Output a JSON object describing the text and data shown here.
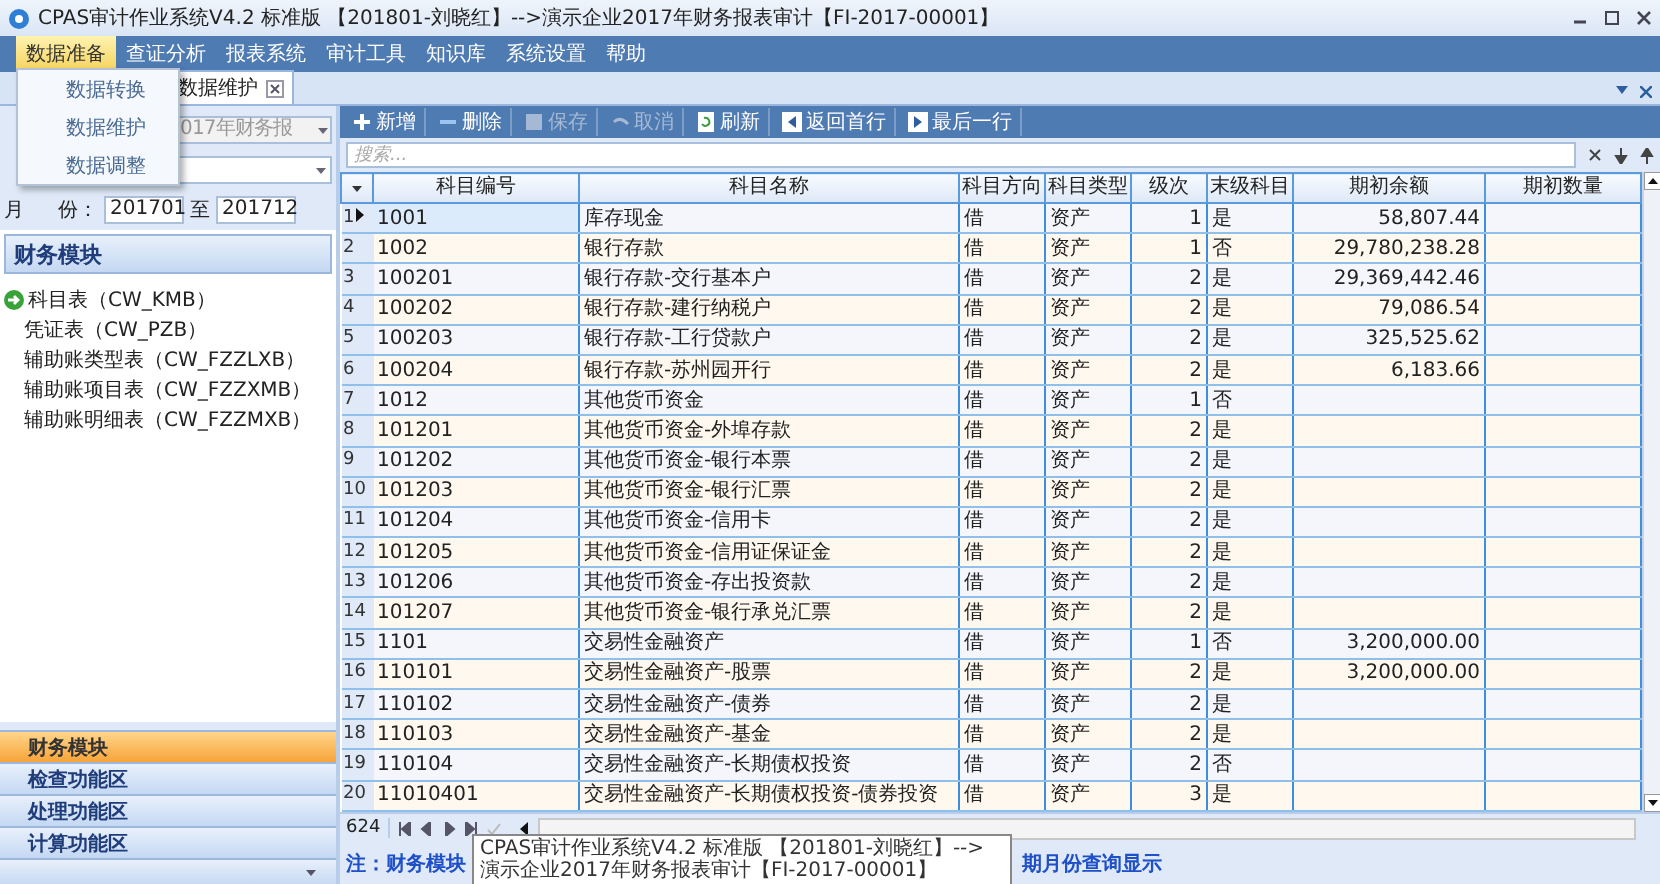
{
  "window": {
    "title": "CPAS审计作业系统V4.2 标准版 【201801-刘晓红】-->演示企业2017年财务报表审计【FI-2017-00001】"
  },
  "menu": [
    {
      "label": "数据准备",
      "selected": true
    },
    {
      "label": "查证分析",
      "selected": false
    },
    {
      "label": "报表系统",
      "selected": false
    },
    {
      "label": "审计工具",
      "selected": false
    },
    {
      "label": "知识库",
      "selected": false
    },
    {
      "label": "系统设置",
      "selected": false
    },
    {
      "label": "帮助",
      "selected": false
    }
  ],
  "dropdown": {
    "items": [
      "数据转换",
      "数据维护",
      "数据调整"
    ]
  },
  "tabs": [
    {
      "label": "数据维护",
      "selected": true
    }
  ],
  "filters": {
    "project_value": "017年财务报",
    "month_label": "月",
    "month_label_2": "份：",
    "from": "201701",
    "to_label": "至",
    "to": "201712"
  },
  "sidebar": {
    "header": "财务模块",
    "items": [
      {
        "label": "科目表（CW_KMB）",
        "selected": true
      },
      {
        "label": "凭证表（CW_PZB）",
        "selected": false
      },
      {
        "label": "辅助账类型表（CW_FZZLXB）",
        "selected": false
      },
      {
        "label": "辅助账项目表（CW_FZZXMB）",
        "selected": false
      },
      {
        "label": "辅助账明细表（CW_FZZMXB）",
        "selected": false
      }
    ],
    "nav": [
      {
        "label": "财务模块",
        "selected": true
      },
      {
        "label": "检查功能区",
        "selected": false
      },
      {
        "label": "处理功能区",
        "selected": false
      },
      {
        "label": "计算功能区",
        "selected": false
      }
    ]
  },
  "toolbar": [
    {
      "label": "新增",
      "kind": "add",
      "disabled": false
    },
    {
      "label": "删除",
      "kind": "delete",
      "disabled": false
    },
    {
      "label": "保存",
      "kind": "save",
      "disabled": true
    },
    {
      "label": "取消",
      "kind": "undo",
      "disabled": true
    },
    {
      "label": "刷新",
      "kind": "refresh",
      "disabled": false
    },
    {
      "label": "返回首行",
      "kind": "first",
      "disabled": false
    },
    {
      "label": "最后一行",
      "kind": "last",
      "disabled": false
    }
  ],
  "search": {
    "placeholder": "搜索..."
  },
  "table": {
    "columns": [
      "科目编号",
      "科目名称",
      "科目方向",
      "科目类型",
      "级次",
      "末级科目",
      "期初余额",
      "期初数量"
    ],
    "rows": [
      {
        "n": "1",
        "selected": true,
        "cells": [
          "1001",
          "库存现金",
          "借",
          "资产",
          "1",
          "是",
          "58,807.44"
        ]
      },
      {
        "n": "2",
        "selected": false,
        "cells": [
          "1002",
          "银行存款",
          "借",
          "资产",
          "1",
          "否",
          "29,780,238.28"
        ]
      },
      {
        "n": "3",
        "selected": false,
        "cells": [
          "100201",
          "银行存款-交行基本户",
          "借",
          "资产",
          "2",
          "是",
          "29,369,442.46"
        ]
      },
      {
        "n": "4",
        "selected": false,
        "cells": [
          "100202",
          "银行存款-建行纳税户",
          "借",
          "资产",
          "2",
          "是",
          "79,086.54"
        ]
      },
      {
        "n": "5",
        "selected": false,
        "cells": [
          "100203",
          "银行存款-工行贷款户",
          "借",
          "资产",
          "2",
          "是",
          "325,525.62"
        ]
      },
      {
        "n": "6",
        "selected": false,
        "cells": [
          "100204",
          "银行存款-苏州园开行",
          "借",
          "资产",
          "2",
          "是",
          "6,183.66"
        ]
      },
      {
        "n": "7",
        "selected": false,
        "cells": [
          "1012",
          "其他货币资金",
          "借",
          "资产",
          "1",
          "否",
          ""
        ]
      },
      {
        "n": "8",
        "selected": false,
        "cells": [
          "101201",
          "其他货币资金-外埠存款",
          "借",
          "资产",
          "2",
          "是",
          ""
        ]
      },
      {
        "n": "9",
        "selected": false,
        "cells": [
          "101202",
          "其他货币资金-银行本票",
          "借",
          "资产",
          "2",
          "是",
          ""
        ]
      },
      {
        "n": "10",
        "selected": false,
        "cells": [
          "101203",
          "其他货币资金-银行汇票",
          "借",
          "资产",
          "2",
          "是",
          ""
        ]
      },
      {
        "n": "11",
        "selected": false,
        "cells": [
          "101204",
          "其他货币资金-信用卡",
          "借",
          "资产",
          "2",
          "是",
          ""
        ]
      },
      {
        "n": "12",
        "selected": false,
        "cells": [
          "101205",
          "其他货币资金-信用证保证金",
          "借",
          "资产",
          "2",
          "是",
          ""
        ]
      },
      {
        "n": "13",
        "selected": false,
        "cells": [
          "101206",
          "其他货币资金-存出投资款",
          "借",
          "资产",
          "2",
          "是",
          ""
        ]
      },
      {
        "n": "14",
        "selected": false,
        "cells": [
          "101207",
          "其他货币资金-银行承兑汇票",
          "借",
          "资产",
          "2",
          "是",
          ""
        ]
      },
      {
        "n": "15",
        "selected": false,
        "cells": [
          "1101",
          "交易性金融资产",
          "借",
          "资产",
          "1",
          "否",
          "3,200,000.00"
        ]
      },
      {
        "n": "16",
        "selected": false,
        "cells": [
          "110101",
          "交易性金融资产-股票",
          "借",
          "资产",
          "2",
          "是",
          "3,200,000.00"
        ]
      },
      {
        "n": "17",
        "selected": false,
        "cells": [
          "110102",
          "交易性金融资产-债券",
          "借",
          "资产",
          "2",
          "是",
          ""
        ]
      },
      {
        "n": "18",
        "selected": false,
        "cells": [
          "110103",
          "交易性金融资产-基金",
          "借",
          "资产",
          "2",
          "是",
          ""
        ]
      },
      {
        "n": "19",
        "selected": false,
        "cells": [
          "110104",
          "交易性金融资产-长期债权投资",
          "借",
          "资产",
          "2",
          "否",
          ""
        ]
      },
      {
        "n": "20",
        "selected": false,
        "cells": [
          "11010401",
          "交易性金融资产-长期债权投资-债券投资",
          "借",
          "资产",
          "3",
          "是",
          ""
        ]
      }
    ]
  },
  "footer": {
    "record_count": "624"
  },
  "note": {
    "start": "注：财务模块",
    "end": "期月份查询显示"
  },
  "tooltip": {
    "text": "CPAS审计作业系统V4.2 标准版 【201801-刘晓红】-->演示企业2017年财务报表审计【FI-2017-00001】"
  }
}
